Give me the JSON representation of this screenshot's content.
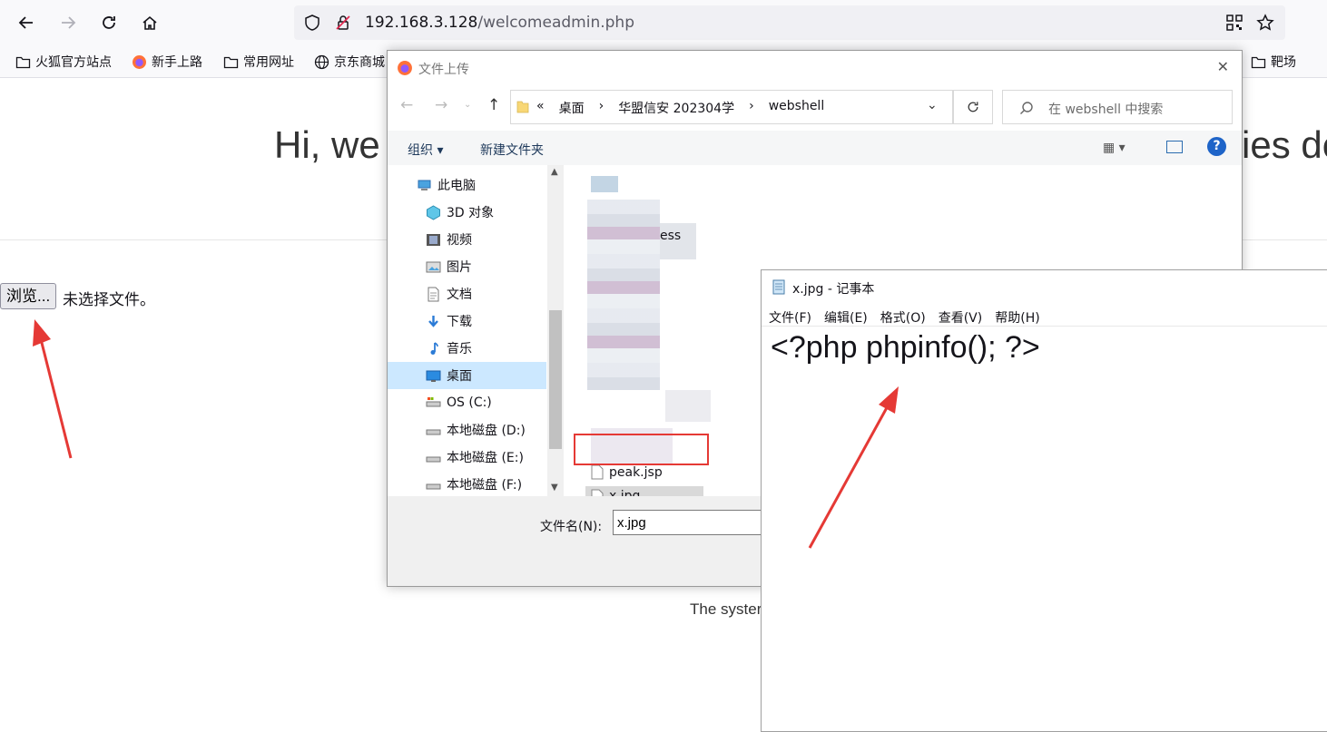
{
  "browser": {
    "url_host": "192.168.3.128",
    "url_path": "/welcomeadmin.php",
    "bookmarks": [
      "火狐官方站点",
      "新手上路",
      "常用网址",
      "京东商城",
      "靶场"
    ]
  },
  "page": {
    "greeting_left": "Hi, we",
    "greeting_right": "ies de",
    "browse_button": "浏览...",
    "no_file_text": "未选择文件。",
    "system_text": "The syster"
  },
  "file_dialog": {
    "title": "文件上传",
    "breadcrumb": [
      "«",
      "桌面",
      "›",
      "华盟信安 202304学",
      "›",
      "webshell"
    ],
    "search_placeholder": "在 webshell 中搜索",
    "toolbar": {
      "organize": "组织 ▾",
      "new_folder": "新建文件夹"
    },
    "nav_items": [
      {
        "label": "此电脑",
        "icon": "computer-icon"
      },
      {
        "label": "3D 对象",
        "icon": "cube-icon"
      },
      {
        "label": "视频",
        "icon": "video-icon"
      },
      {
        "label": "图片",
        "icon": "picture-icon"
      },
      {
        "label": "文档",
        "icon": "document-icon"
      },
      {
        "label": "下载",
        "icon": "download-icon"
      },
      {
        "label": "音乐",
        "icon": "music-icon"
      },
      {
        "label": "桌面",
        "icon": "desktop-icon",
        "selected": true
      },
      {
        "label": "OS (C:)",
        "icon": "drive-icon"
      },
      {
        "label": "本地磁盘 (D:)",
        "icon": "drive-icon"
      },
      {
        "label": "本地磁盘 (E:)",
        "icon": "drive-icon"
      },
      {
        "label": "本地磁盘 (F:)",
        "icon": "drive-icon"
      }
    ],
    "files": [
      "ess",
      "peak.jsp",
      "x.jpg"
    ],
    "filename_label": "文件名(N):",
    "filename_value": "x.jpg"
  },
  "notepad": {
    "title": "x.jpg - 记事本",
    "menu": [
      "文件(F)",
      "编辑(E)",
      "格式(O)",
      "查看(V)",
      "帮助(H)"
    ],
    "content": "<?php phpinfo(); ?>"
  },
  "colors": {
    "annotation_red": "#e53935",
    "selection_blue": "#cce8ff"
  }
}
